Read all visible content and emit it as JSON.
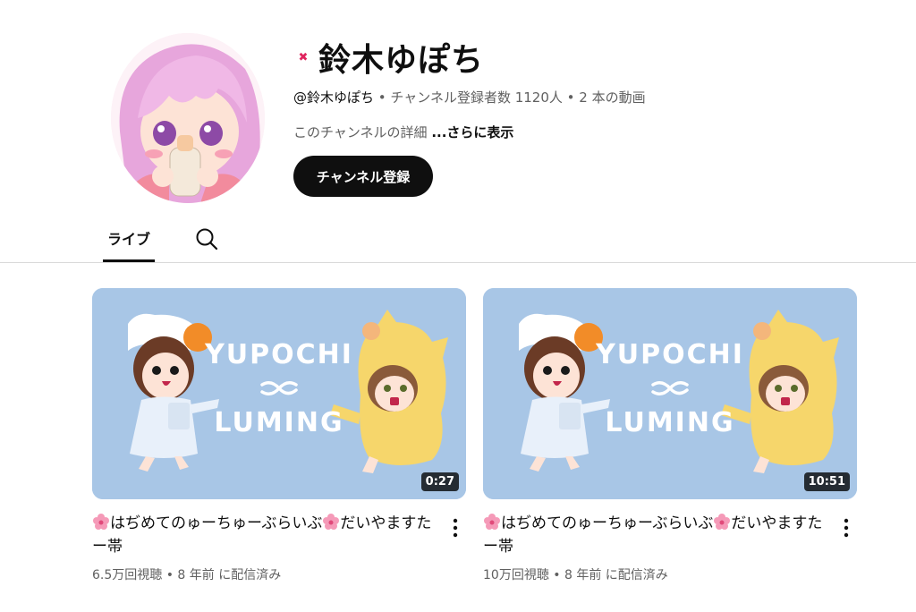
{
  "channel": {
    "name": "鈴木ゆぽち",
    "handle": "@鈴木ゆぽち",
    "meta": " • チャンネル登録者数 1120人 • 2 本の動画",
    "description": "このチャンネルの詳細 ",
    "more_label": "...さらに表示",
    "subscribe_label": "チャンネル登録"
  },
  "tabs": {
    "live_label": "ライブ",
    "search_icon": "search-icon"
  },
  "videos": [
    {
      "thumb_text_1": "YUPOCHI",
      "thumb_text_2": "LUMING",
      "duration": "0:27",
      "title": "はぢめてのゅーちゅーぶらいぶ",
      "title_2": "だいやますたー帯",
      "stats": "6.5万回視聴 • 8 年前 に配信済み"
    },
    {
      "thumb_text_1": "YUPOCHI",
      "thumb_text_2": "LUMING",
      "duration": "10:51",
      "title": "はぢめてのゅーちゅーぶらいぶ",
      "title_2": "だいやますたー帯",
      "stats": "10万回視聴 • 8 年前 に配信済み"
    }
  ],
  "colors": {
    "thumb_bg": "#a8c6e6",
    "subscribe_bg": "#0f0f0f",
    "secondary_text": "#606060"
  }
}
